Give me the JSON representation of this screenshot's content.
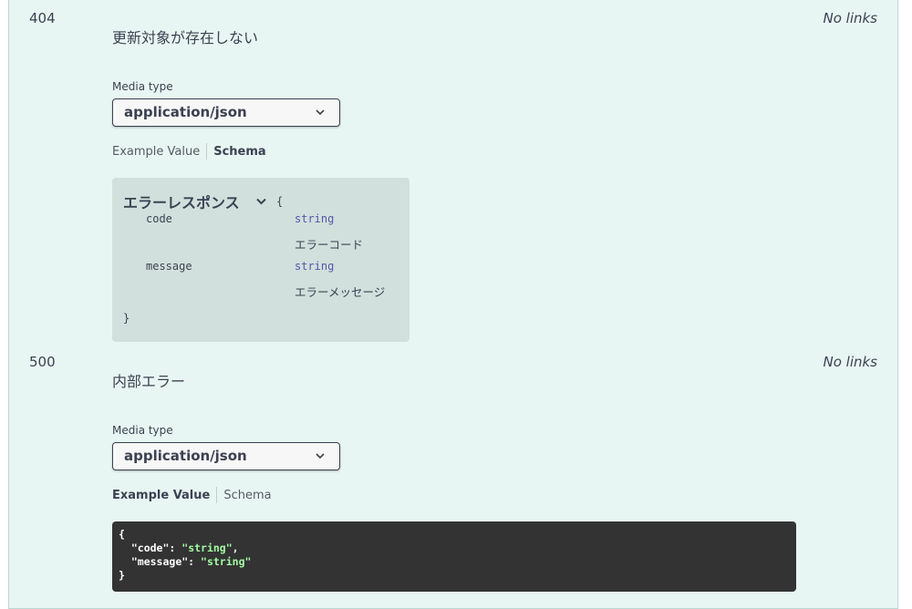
{
  "responses": [
    {
      "code": "404",
      "description": "更新対象が存在しない",
      "links": "No links",
      "media_type_label": "Media type",
      "media_type": "application/json",
      "tabs": {
        "example": "Example Value",
        "schema": "Schema",
        "active": "schema"
      },
      "schema": {
        "model_name": "エラーレスポンス",
        "open_bracket": "{",
        "close_bracket": "}",
        "properties": [
          {
            "name": "code",
            "type": "string",
            "description": "エラーコード"
          },
          {
            "name": "message",
            "type": "string",
            "description": "エラーメッセージ"
          }
        ]
      }
    },
    {
      "code": "500",
      "description": "内部エラー",
      "links": "No links",
      "media_type_label": "Media type",
      "media_type": "application/json",
      "tabs": {
        "example": "Example Value",
        "schema": "Schema",
        "active": "example"
      },
      "example": {
        "open": "{",
        "line1_key": "\"code\"",
        "line1_val": "\"string\"",
        "line2_key": "\"message\"",
        "line2_val": "\"string\"",
        "close": "}"
      }
    }
  ],
  "colors": {
    "panel_bg": "#e8f6f3",
    "schema_bg": "#d1e0dc",
    "example_bg": "#333333",
    "string_color": "#a2fca2",
    "type_color": "#5555aa"
  }
}
